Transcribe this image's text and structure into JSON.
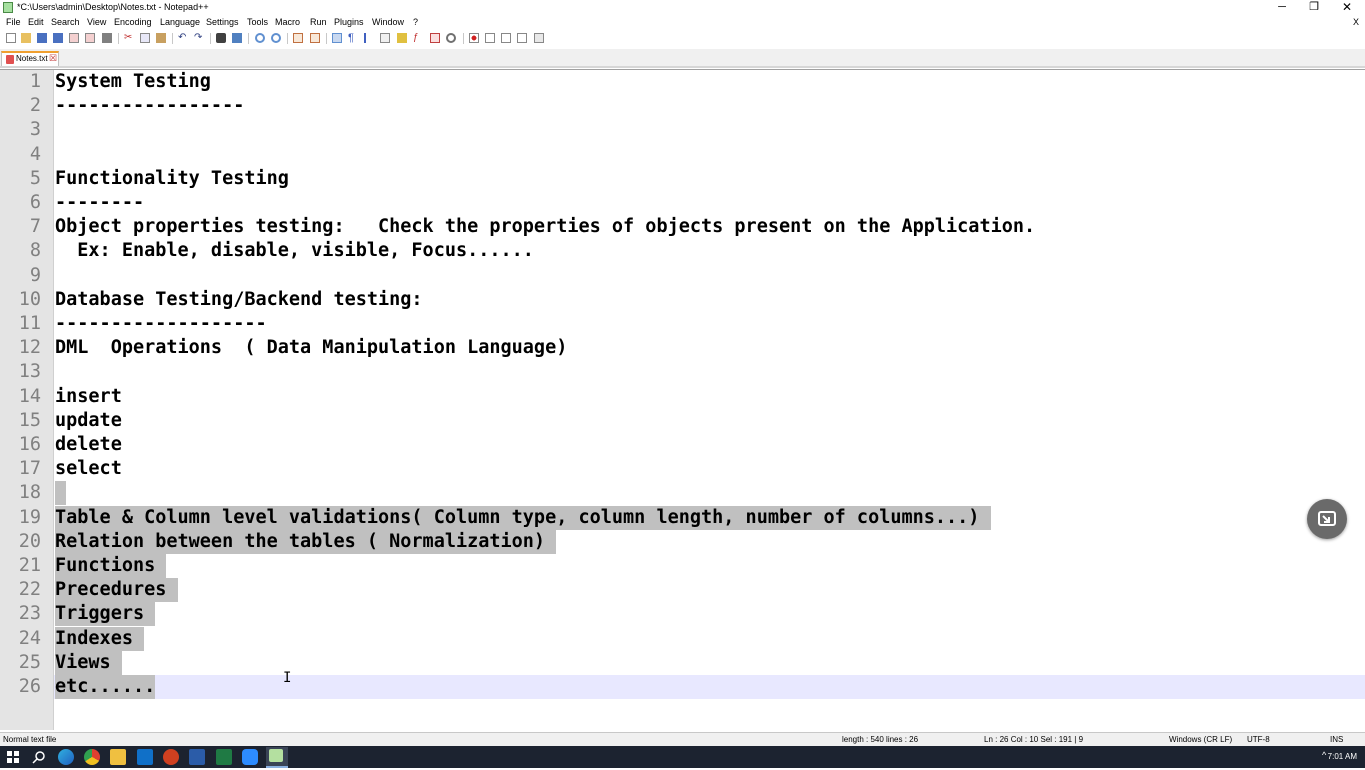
{
  "window": {
    "title": "*C:\\Users\\admin\\Desktop\\Notes.txt - Notepad++"
  },
  "controls": {
    "minimize": "─",
    "maximize": "❐",
    "close": "✕"
  },
  "menu": [
    "File",
    "Edit",
    "Search",
    "View",
    "Encoding",
    "Language",
    "Settings",
    "Tools",
    "Macro",
    "Run",
    "Plugins",
    "Window",
    "?"
  ],
  "menu_close": "X",
  "tabs": [
    {
      "label": "Notes.txt",
      "close": "☒"
    }
  ],
  "editor": {
    "lines": [
      {
        "num": "1",
        "text": "System Testing"
      },
      {
        "num": "2",
        "text": "-----------------"
      },
      {
        "num": "3",
        "text": ""
      },
      {
        "num": "4",
        "text": ""
      },
      {
        "num": "5",
        "text": "Functionality Testing"
      },
      {
        "num": "6",
        "text": "--------"
      },
      {
        "num": "7",
        "text": "Object properties testing:   Check the properties of objects present on the Application."
      },
      {
        "num": "8",
        "text": "  Ex: Enable, disable, visible, Focus......"
      },
      {
        "num": "9",
        "text": ""
      },
      {
        "num": "10",
        "text": "Database Testing/Backend testing:"
      },
      {
        "num": "11",
        "text": "-------------------"
      },
      {
        "num": "12",
        "text": "DML  Operations  ( Data Manipulation Language)"
      },
      {
        "num": "13",
        "text": ""
      },
      {
        "num": "14",
        "text": "insert"
      },
      {
        "num": "15",
        "text": "update"
      },
      {
        "num": "16",
        "text": "delete"
      },
      {
        "num": "17",
        "text": "select"
      },
      {
        "num": "18",
        "text": " "
      },
      {
        "num": "19",
        "text": "Table & Column level validations( Column type, column length, number of columns...) "
      },
      {
        "num": "20",
        "text": "Relation between the tables ( Normalization) "
      },
      {
        "num": "21",
        "text": "Functions "
      },
      {
        "num": "22",
        "text": "Precedures "
      },
      {
        "num": "23",
        "text": "Triggers "
      },
      {
        "num": "24",
        "text": "Indexes "
      },
      {
        "num": "25",
        "text": "Views "
      },
      {
        "num": "26",
        "text": "etc......"
      }
    ],
    "cursor_icon": "I"
  },
  "status": {
    "file_type": "Normal text file",
    "length_lines": "length : 540    lines : 26",
    "position": "Ln : 26    Col : 10    Sel : 191 | 9",
    "eol": "Windows (CR LF)",
    "encoding": "UTF-8",
    "mode": "INS"
  },
  "taskbar": {
    "icons": [
      "windows-start-icon",
      "search-icon",
      "edge-icon",
      "chrome-icon",
      "file-explorer-icon",
      "outlook-icon",
      "powerpoint-icon",
      "word-icon",
      "excel-icon",
      "zoom-icon",
      "notepadpp-icon"
    ],
    "tray_up": "^",
    "time": "7:01 AM"
  },
  "colors": {
    "selection": "#c0c0c0",
    "current_line": "#e8e8ff",
    "gutter": "#e4e4e4",
    "tab_accent": "#f0a030"
  }
}
